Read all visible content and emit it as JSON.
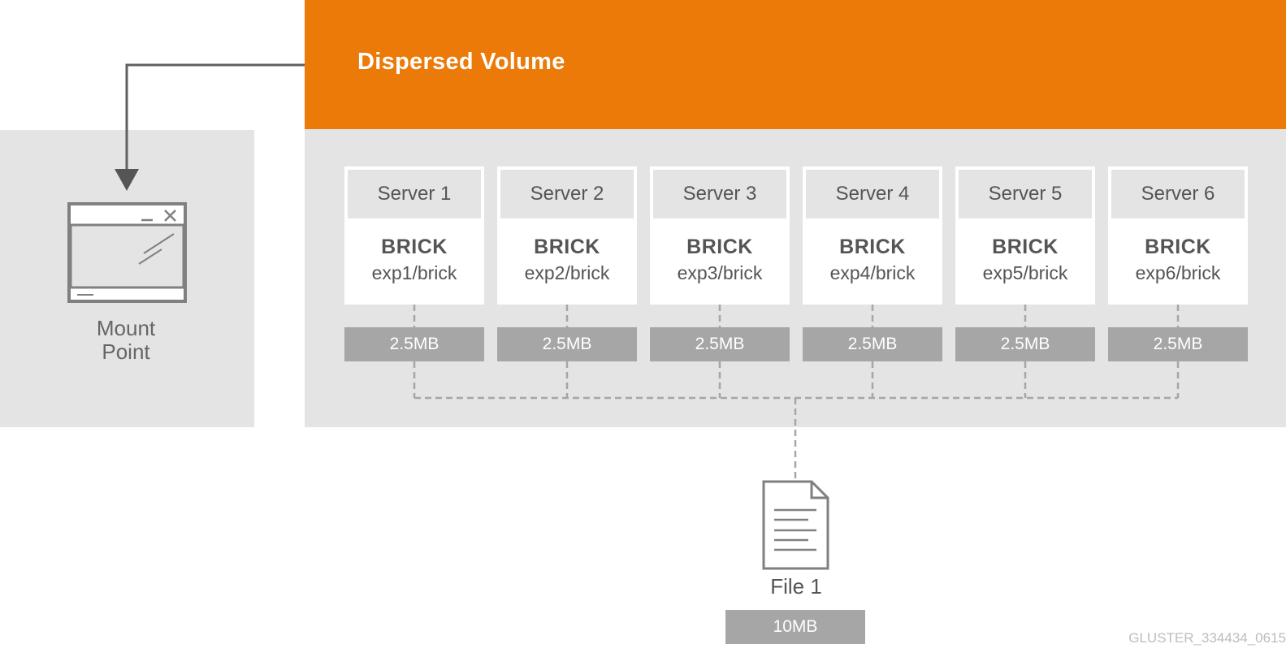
{
  "volume": {
    "title": "Dispersed Volume",
    "accent_color": "#ec7a08",
    "servers": [
      {
        "name": "Server 1",
        "brick_label": "BRICK",
        "brick_path": "exp1/brick",
        "chunk": "2.5MB"
      },
      {
        "name": "Server 2",
        "brick_label": "BRICK",
        "brick_path": "exp2/brick",
        "chunk": "2.5MB"
      },
      {
        "name": "Server 3",
        "brick_label": "BRICK",
        "brick_path": "exp3/brick",
        "chunk": "2.5MB"
      },
      {
        "name": "Server 4",
        "brick_label": "BRICK",
        "brick_path": "exp4/brick",
        "chunk": "2.5MB"
      },
      {
        "name": "Server 5",
        "brick_label": "BRICK",
        "brick_path": "exp5/brick",
        "chunk": "2.5MB"
      },
      {
        "name": "Server 6",
        "brick_label": "BRICK",
        "brick_path": "exp6/brick",
        "chunk": "2.5MB"
      }
    ]
  },
  "client": {
    "label_line1": "Mount",
    "label_line2": "Point",
    "icon": "application-window-icon"
  },
  "file": {
    "name": "File 1",
    "size": "10MB",
    "icon": "document-icon"
  },
  "figure_id": "GLUSTER_334434_0615"
}
